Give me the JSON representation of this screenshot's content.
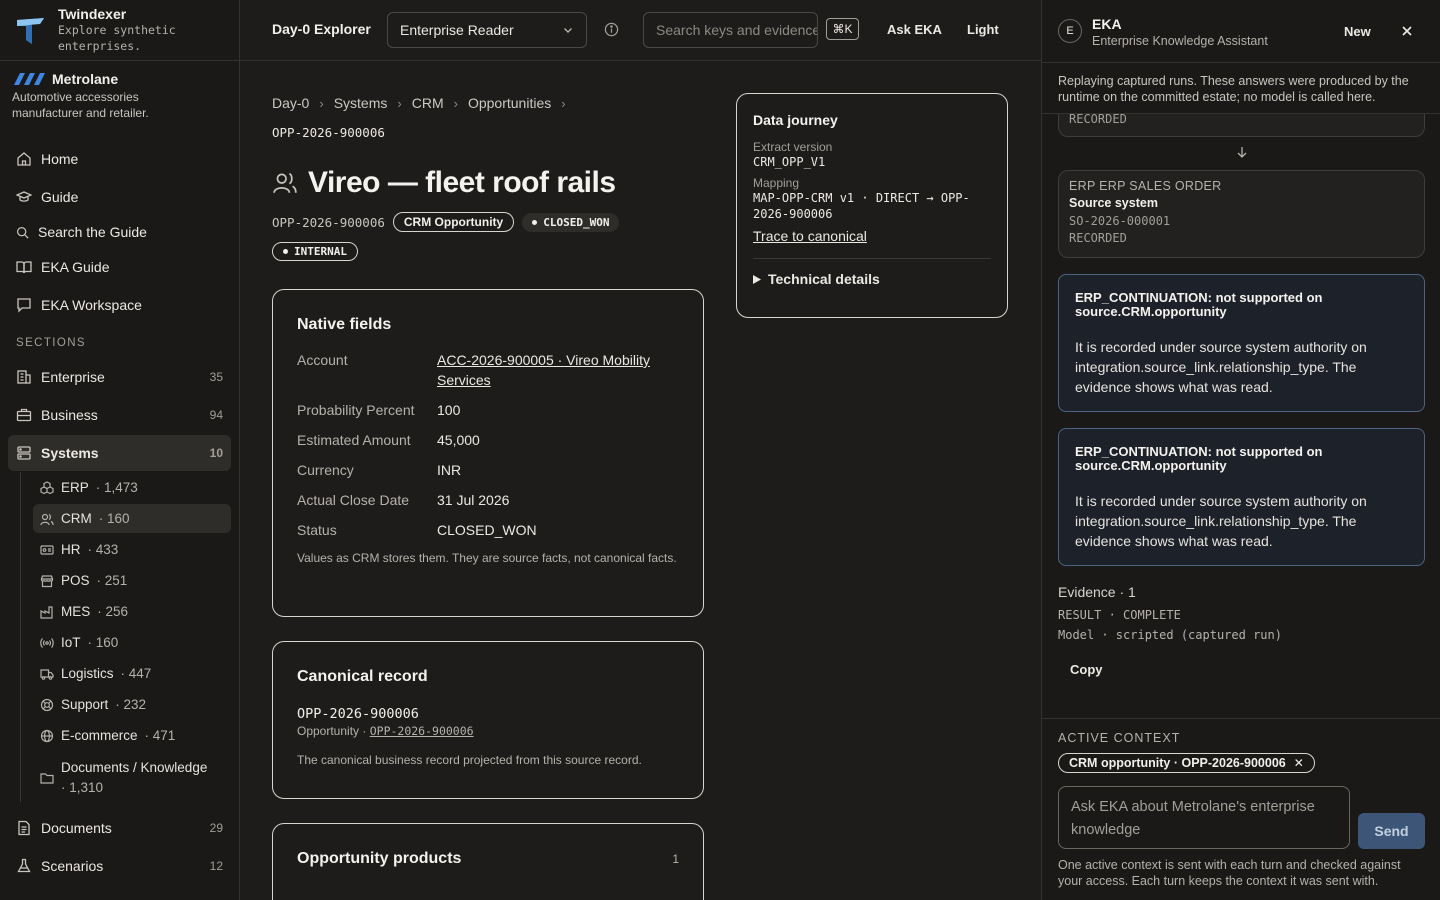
{
  "brand": {
    "name": "Twindexer",
    "tagline": "Explore synthetic enterprises."
  },
  "tenant": {
    "name": "Metrolane",
    "description": "Automotive accessories manufacturer and retailer."
  },
  "nav": {
    "home": "Home",
    "guide": "Guide",
    "search_guide": "Search the Guide",
    "eka_guide": "EKA Guide",
    "eka_workspace": "EKA Workspace",
    "sections_label": "SECTIONS",
    "enterprise": {
      "label": "Enterprise",
      "count": "35"
    },
    "business": {
      "label": "Business",
      "count": "94"
    },
    "systems": {
      "label": "Systems",
      "count": "10"
    },
    "documents": {
      "label": "Documents",
      "count": "29"
    },
    "scenarios": {
      "label": "Scenarios",
      "count": "12"
    }
  },
  "systems": [
    {
      "name": "ERP",
      "count": "· 1,473"
    },
    {
      "name": "CRM",
      "count": "· 160"
    },
    {
      "name": "HR",
      "count": "· 433"
    },
    {
      "name": "POS",
      "count": "· 251"
    },
    {
      "name": "MES",
      "count": "· 256"
    },
    {
      "name": "IoT",
      "count": "· 160"
    },
    {
      "name": "Logistics",
      "count": "· 447"
    },
    {
      "name": "Support",
      "count": "· 232"
    },
    {
      "name": "E-commerce",
      "count": "· 471"
    },
    {
      "name": "Documents / Knowledge",
      "count": "· 1,310"
    }
  ],
  "topbar": {
    "title": "Day-0 Explorer",
    "role": "Enterprise Reader",
    "search_placeholder": "Search keys and evidence",
    "shortcut": "⌘K",
    "ask": "Ask EKA",
    "theme": "Light"
  },
  "breadcrumb": [
    "Day-0",
    "Systems",
    "CRM",
    "Opportunities"
  ],
  "record": {
    "id": "OPP-2026-900006",
    "title": "Vireo — fleet roof rails",
    "type_badge": "CRM Opportunity",
    "status_badge": "CLOSED_WON",
    "classification": "INTERNAL"
  },
  "native_fields": {
    "title": "Native fields",
    "rows": [
      {
        "k": "Account",
        "v": "ACC-2026-900005 · Vireo Mobility Services",
        "link": true
      },
      {
        "k": "Probability Percent",
        "v": "100"
      },
      {
        "k": "Estimated Amount",
        "v": "45,000"
      },
      {
        "k": "Currency",
        "v": "INR"
      },
      {
        "k": "Actual Close Date",
        "v": "31 Jul 2026"
      },
      {
        "k": "Status",
        "v": "CLOSED_WON"
      }
    ],
    "note": "Values as CRM stores them. They are source facts, not canonical facts."
  },
  "canonical": {
    "title": "Canonical record",
    "id": "OPP-2026-900006",
    "kind": "Opportunity ·",
    "link": "OPP-2026-900006",
    "note": "The canonical business record projected from this source record."
  },
  "products": {
    "title": "Opportunity products",
    "count": "1"
  },
  "journey": {
    "title": "Data journey",
    "extract_label": "Extract version",
    "extract_value": "CRM_OPP_V1",
    "mapping_label": "Mapping",
    "mapping_value": "MAP-OPP-CRM v1 · DIRECT → OPP-2026-900006",
    "trace_link": "Trace to canonical",
    "details": "Technical details"
  },
  "panel": {
    "avatar": "E",
    "name": "EKA",
    "subtitle": "Enterprise Knowledge Assistant",
    "new": "New",
    "banner": "Replaying captured runs. These answers were produced by the runtime on the committed estate; no model is called here.",
    "prev_status": "RECORDED",
    "source_card": {
      "kind": "ERP ERP SALES ORDER",
      "name": "Source system",
      "id": "SO-2026-000001",
      "status": "RECORDED"
    },
    "messages": [
      {
        "title": "ERP_CONTINUATION: not supported on source.CRM.opportunity",
        "body": "It is recorded under source system authority on integration.source_link.relationship_type. The evidence shows what was read."
      },
      {
        "title": "ERP_CONTINUATION: not supported on source.CRM.opportunity",
        "body": "It is recorded under source system authority on integration.source_link.relationship_type. The evidence shows what was read."
      }
    ],
    "evidence_title": "Evidence · 1",
    "evidence_result": "RESULT · COMPLETE",
    "evidence_model": "Model · scripted (captured run)",
    "copy": "Copy",
    "context_label": "ACTIVE CONTEXT",
    "context_chip": "CRM opportunity · OPP-2026-900006",
    "ask_placeholder": "Ask EKA about Metrolane's enterprise knowledge",
    "send": "Send",
    "context_note": "One active context is sent with each turn and checked against your access. Each turn keeps the context it was sent with."
  }
}
